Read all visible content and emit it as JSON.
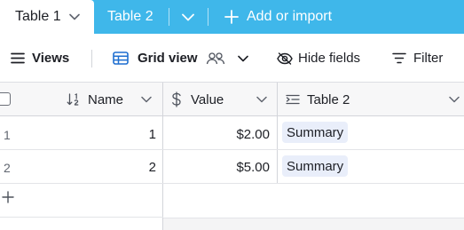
{
  "tabs": {
    "active": {
      "label": "Table 1"
    },
    "second": {
      "label": "Table 2"
    },
    "add_label": "Add or import"
  },
  "toolbar": {
    "views_label": "Views",
    "grid_view_label": "Grid view",
    "hide_fields_label": "Hide fields",
    "filter_label": "Filter"
  },
  "columns": [
    {
      "label": "Name",
      "type_icon": "sort-numeric-icon"
    },
    {
      "label": "Value",
      "type_icon": "dollar-icon"
    },
    {
      "label": "Table 2",
      "type_icon": "lookup-icon"
    }
  ],
  "rows": [
    {
      "row_number": "1",
      "name": "1",
      "value": "$2.00",
      "link": "Summary"
    },
    {
      "row_number": "2",
      "name": "2",
      "value": "$5.00",
      "link": "Summary"
    }
  ],
  "colors": {
    "tabbar_bg": "#3fb7ea",
    "grid_view_icon": "#1f6fd0",
    "link_pill_bg": "#e9eefa"
  }
}
